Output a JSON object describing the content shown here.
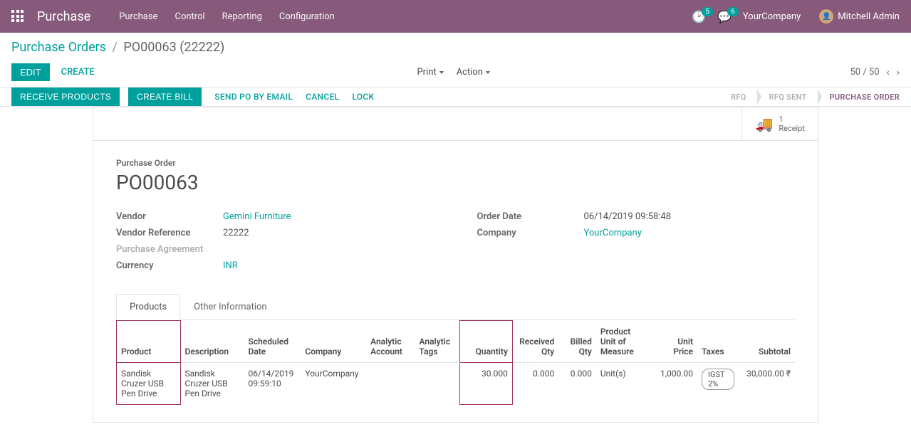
{
  "nav": {
    "app_name": "Purchase",
    "menu": [
      "Purchase",
      "Control",
      "Reporting",
      "Configuration"
    ],
    "clock_badge": "5",
    "chat_badge": "6",
    "company": "YourCompany",
    "user": "Mitchell Admin"
  },
  "breadcrumb": {
    "parent": "Purchase Orders",
    "current": "PO00063 (22222)"
  },
  "controls": {
    "edit": "EDIT",
    "create": "CREATE",
    "print": "Print",
    "action": "Action",
    "pager": "50 / 50"
  },
  "actions": {
    "receive": "RECEIVE PRODUCTS",
    "create_bill": "CREATE BILL",
    "send_po": "SEND PO BY EMAIL",
    "cancel": "CANCEL",
    "lock": "LOCK"
  },
  "status": {
    "rfq": "RFQ",
    "rfq_sent": "RFQ SENT",
    "purchase_order": "PURCHASE ORDER"
  },
  "stat": {
    "count": "1",
    "label": "Receipt"
  },
  "form": {
    "title_label": "Purchase Order",
    "title": "PO00063",
    "labels": {
      "vendor": "Vendor",
      "vendor_ref": "Vendor Reference",
      "purchase_agreement": "Purchase Agreement",
      "currency": "Currency",
      "order_date": "Order Date",
      "company": "Company"
    },
    "values": {
      "vendor": "Gemini Furniture",
      "vendor_ref": "22222",
      "currency": "INR",
      "order_date": "06/14/2019 09:58:48",
      "company": "YourCompany"
    }
  },
  "tabs": {
    "products": "Products",
    "other": "Other Information"
  },
  "table": {
    "headers": {
      "product": "Product",
      "description": "Description",
      "scheduled_date": "Scheduled Date",
      "company": "Company",
      "analytic_account": "Analytic Account",
      "analytic_tags": "Analytic Tags",
      "quantity": "Quantity",
      "received_qty": "Received Qty",
      "billed_qty": "Billed Qty",
      "uom": "Product Unit of Measure",
      "unit_price": "Unit Price",
      "taxes": "Taxes",
      "subtotal": "Subtotal"
    },
    "rows": [
      {
        "product": "Sandisk Cruzer USB Pen Drive",
        "description": "Sandisk Cruzer USB Pen Drive",
        "scheduled_date": "06/14/2019 09:59:10",
        "company": "YourCompany",
        "analytic_account": "",
        "analytic_tags": "",
        "quantity": "30.000",
        "received_qty": "0.000",
        "billed_qty": "0.000",
        "uom": "Unit(s)",
        "unit_price": "1,000.00",
        "taxes": "IGST 2%",
        "subtotal": "30,000.00 ₹"
      }
    ]
  }
}
